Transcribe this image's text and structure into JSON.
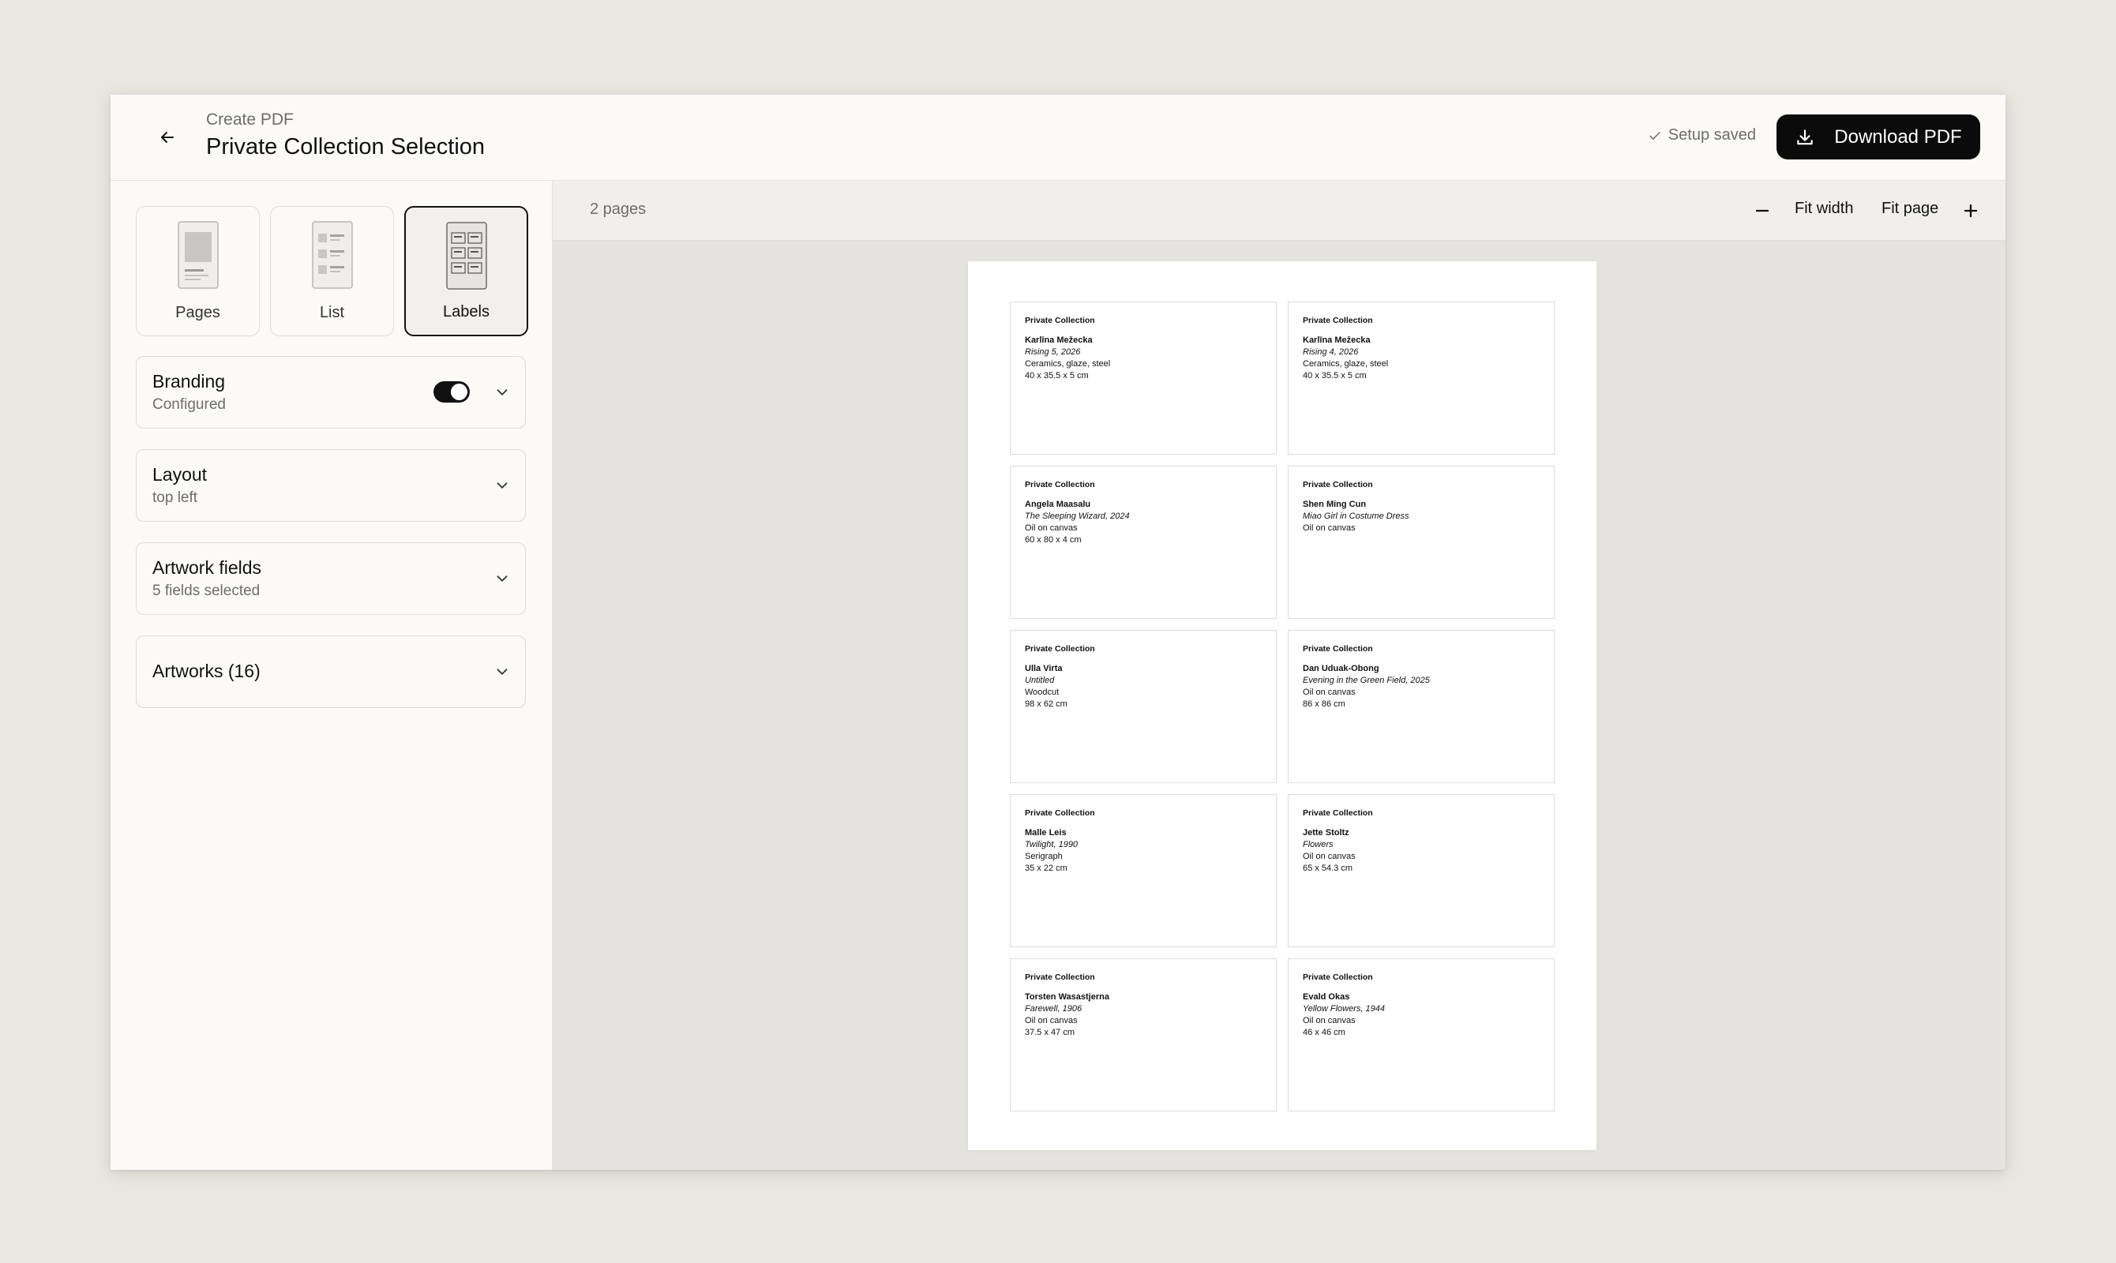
{
  "header": {
    "eyebrow": "Create PDF",
    "title": "Private Collection Selection",
    "saved_text": "Setup saved",
    "download_label": "Download PDF"
  },
  "sidebar": {
    "formats": [
      {
        "label": "Pages",
        "active": false
      },
      {
        "label": "List",
        "active": false
      },
      {
        "label": "Labels",
        "active": true
      }
    ],
    "sections": {
      "branding": {
        "title": "Branding",
        "subtitle": "Configured",
        "toggle_on": true
      },
      "layout": {
        "title": "Layout",
        "subtitle": "top left"
      },
      "fields": {
        "title": "Artwork fields",
        "subtitle": "5 fields selected"
      },
      "artworks": {
        "title": "Artworks (16)"
      }
    }
  },
  "preview": {
    "page_count": "2 pages",
    "fit_width": "Fit width",
    "fit_page": "Fit page"
  },
  "labels": [
    {
      "collection": "Private Collection",
      "artist": "Karlīna Mežecka",
      "title": "Rising 5, 2026",
      "medium": "Ceramics, glaze, steel",
      "dimensions": "40 x 35.5 x 5 cm"
    },
    {
      "collection": "Private Collection",
      "artist": "Karlīna Mežecka",
      "title": "Rising 4, 2026",
      "medium": "Ceramics, glaze, steel",
      "dimensions": "40 x 35.5 x 5 cm"
    },
    {
      "collection": "Private Collection",
      "artist": "Angela Maasalu",
      "title": "The Sleeping Wizard, 2024",
      "medium": "Oil on canvas",
      "dimensions": "60 x 80 x 4 cm"
    },
    {
      "collection": "Private Collection",
      "artist": "Shen Ming Cun",
      "title": "Miao Girl in Costume Dress",
      "medium": "Oil on canvas",
      "dimensions": ""
    },
    {
      "collection": "Private Collection",
      "artist": "Ulla Virta",
      "title": "Untitled",
      "medium": "Woodcut",
      "dimensions": "98 x 62 cm"
    },
    {
      "collection": "Private Collection",
      "artist": "Dan Uduak-Obong",
      "title": "Evening in the Green Field, 2025",
      "medium": "Oil on canvas",
      "dimensions": "86 x 86 cm"
    },
    {
      "collection": "Private Collection",
      "artist": "Malle Leis",
      "title": "Twilight, 1990",
      "medium": "Serigraph",
      "dimensions": "35 x 22 cm"
    },
    {
      "collection": "Private Collection",
      "artist": "Jette Stoltz",
      "title": "Flowers",
      "medium": "Oil on canvas",
      "dimensions": "65 x 54.3 cm"
    },
    {
      "collection": "Private Collection",
      "artist": "Torsten Wasastjerna",
      "title": "Farewell, 1906",
      "medium": "Oil on canvas",
      "dimensions": "37.5 x 47 cm"
    },
    {
      "collection": "Private Collection",
      "artist": "Evald Okas",
      "title": "Yellow Flowers, 1944",
      "medium": "Oil on canvas",
      "dimensions": "46 x 46 cm"
    }
  ]
}
